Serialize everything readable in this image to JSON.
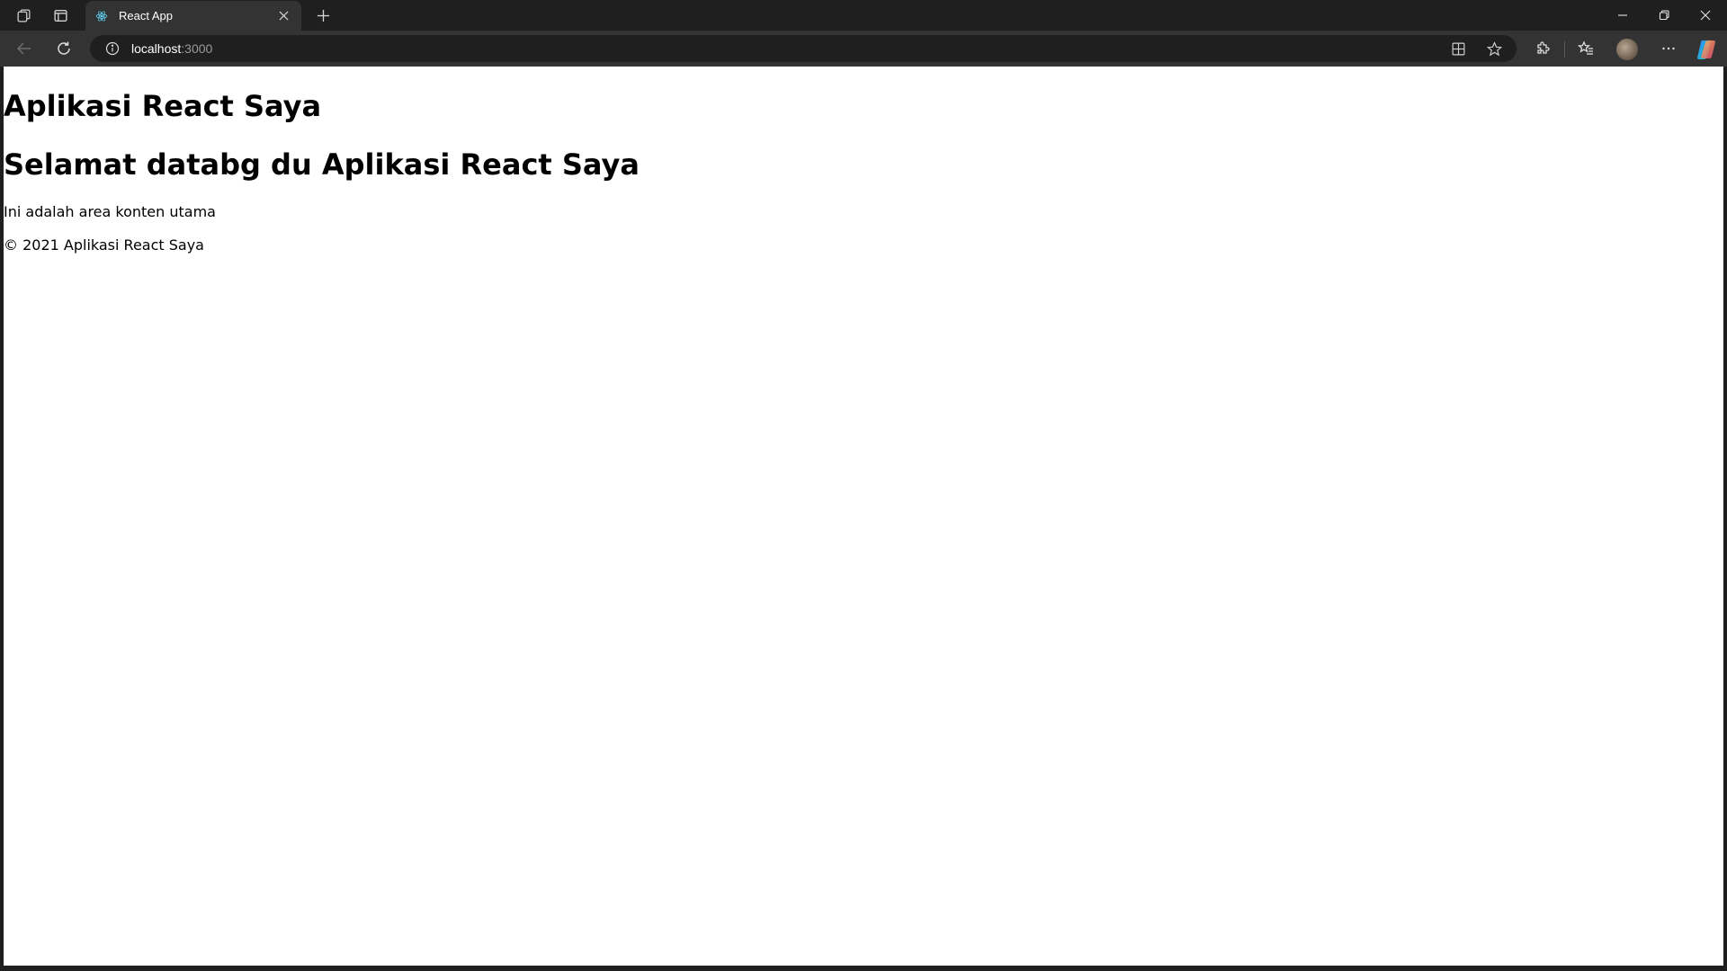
{
  "browser": {
    "tab": {
      "title": "React App",
      "favicon": "react-logo-icon"
    },
    "address_bar": {
      "host": "localhost",
      "port": ":3000"
    },
    "icons": {
      "workspaces": "workspaces-icon",
      "tab_actions": "tab-actions-icon",
      "new_tab": "plus-icon",
      "back": "back-arrow-icon",
      "refresh": "refresh-icon",
      "site_info": "info-icon",
      "app_available": "app-available-icon",
      "favorite": "star-icon",
      "extensions": "puzzle-icon",
      "favorites": "favorites-icon",
      "profile": "avatar",
      "menu": "more-icon",
      "copilot": "copilot-icon",
      "minimize": "minimize-icon",
      "restore": "restore-icon",
      "close": "close-icon"
    },
    "colors": {
      "chrome": "#1f1f1f",
      "toolbar": "#333333",
      "page_bg": "#ffffff"
    }
  },
  "page": {
    "app_title": "Aplikasi React Saya",
    "welcome_title": "Selamat databg du Aplikasi React Saya",
    "main_text": "Ini adalah area konten utama",
    "footer_text": "© 2021 Aplikasi React Saya"
  }
}
